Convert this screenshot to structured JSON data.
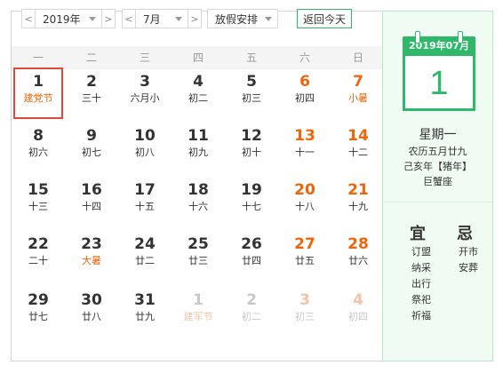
{
  "toolbar": {
    "year_value": "2019年",
    "month_value": "7月",
    "holiday_value": "放假安排",
    "today_label": "返回今天",
    "prev_glyph": "<",
    "next_glyph": ">"
  },
  "weekdays": [
    "一",
    "二",
    "三",
    "四",
    "五",
    "六",
    "日"
  ],
  "days": [
    {
      "num": "1",
      "sub": "建党节",
      "weekend": false,
      "festival": true,
      "other": false,
      "today": true
    },
    {
      "num": "2",
      "sub": "三十",
      "weekend": false,
      "festival": false,
      "other": false
    },
    {
      "num": "3",
      "sub": "六月小",
      "weekend": false,
      "festival": false,
      "other": false
    },
    {
      "num": "4",
      "sub": "初二",
      "weekend": false,
      "festival": false,
      "other": false
    },
    {
      "num": "5",
      "sub": "初三",
      "weekend": false,
      "festival": false,
      "other": false
    },
    {
      "num": "6",
      "sub": "初四",
      "weekend": true,
      "festival": false,
      "other": false
    },
    {
      "num": "7",
      "sub": "小暑",
      "weekend": true,
      "festival": true,
      "other": false
    },
    {
      "num": "8",
      "sub": "初六",
      "weekend": false,
      "festival": false,
      "other": false
    },
    {
      "num": "9",
      "sub": "初七",
      "weekend": false,
      "festival": false,
      "other": false
    },
    {
      "num": "10",
      "sub": "初八",
      "weekend": false,
      "festival": false,
      "other": false
    },
    {
      "num": "11",
      "sub": "初九",
      "weekend": false,
      "festival": false,
      "other": false
    },
    {
      "num": "12",
      "sub": "初十",
      "weekend": false,
      "festival": false,
      "other": false
    },
    {
      "num": "13",
      "sub": "十一",
      "weekend": true,
      "festival": false,
      "other": false
    },
    {
      "num": "14",
      "sub": "十二",
      "weekend": true,
      "festival": false,
      "other": false
    },
    {
      "num": "15",
      "sub": "十三",
      "weekend": false,
      "festival": false,
      "other": false
    },
    {
      "num": "16",
      "sub": "十四",
      "weekend": false,
      "festival": false,
      "other": false
    },
    {
      "num": "17",
      "sub": "十五",
      "weekend": false,
      "festival": false,
      "other": false
    },
    {
      "num": "18",
      "sub": "十六",
      "weekend": false,
      "festival": false,
      "other": false
    },
    {
      "num": "19",
      "sub": "十七",
      "weekend": false,
      "festival": false,
      "other": false
    },
    {
      "num": "20",
      "sub": "十八",
      "weekend": true,
      "festival": false,
      "other": false
    },
    {
      "num": "21",
      "sub": "十九",
      "weekend": true,
      "festival": false,
      "other": false
    },
    {
      "num": "22",
      "sub": "二十",
      "weekend": false,
      "festival": false,
      "other": false
    },
    {
      "num": "23",
      "sub": "大暑",
      "weekend": false,
      "festival": true,
      "other": false
    },
    {
      "num": "24",
      "sub": "廿二",
      "weekend": false,
      "festival": false,
      "other": false
    },
    {
      "num": "25",
      "sub": "廿三",
      "weekend": false,
      "festival": false,
      "other": false
    },
    {
      "num": "26",
      "sub": "廿四",
      "weekend": false,
      "festival": false,
      "other": false
    },
    {
      "num": "27",
      "sub": "廿五",
      "weekend": true,
      "festival": false,
      "other": false
    },
    {
      "num": "28",
      "sub": "廿六",
      "weekend": true,
      "festival": false,
      "other": false
    },
    {
      "num": "29",
      "sub": "廿七",
      "weekend": false,
      "festival": false,
      "other": false
    },
    {
      "num": "30",
      "sub": "廿八",
      "weekend": false,
      "festival": false,
      "other": false
    },
    {
      "num": "31",
      "sub": "廿九",
      "weekend": false,
      "festival": false,
      "other": false
    },
    {
      "num": "1",
      "sub": "建军节",
      "weekend": false,
      "festival": true,
      "other": true
    },
    {
      "num": "2",
      "sub": "初二",
      "weekend": false,
      "festival": false,
      "other": true
    },
    {
      "num": "3",
      "sub": "初三",
      "weekend": true,
      "festival": false,
      "other": true
    },
    {
      "num": "4",
      "sub": "初四",
      "weekend": true,
      "festival": false,
      "other": true
    }
  ],
  "panel": {
    "cal_header": "2019年07月",
    "cal_day": "1",
    "weekday": "星期一",
    "lunar_line1": "农历五月廿九",
    "lunar_line2": "己亥年【猪年】",
    "zodiac": "巨蟹座",
    "yi_title": "宜",
    "ji_title": "忌",
    "yi_items": [
      "订盟",
      "纳采",
      "出行",
      "祭祀",
      "祈福"
    ],
    "ji_items": [
      "开市",
      "安葬"
    ]
  },
  "colors": {
    "accent_green": "#2fb86a",
    "weekend_orange": "#f0640a",
    "today_border": "#e2483a"
  }
}
